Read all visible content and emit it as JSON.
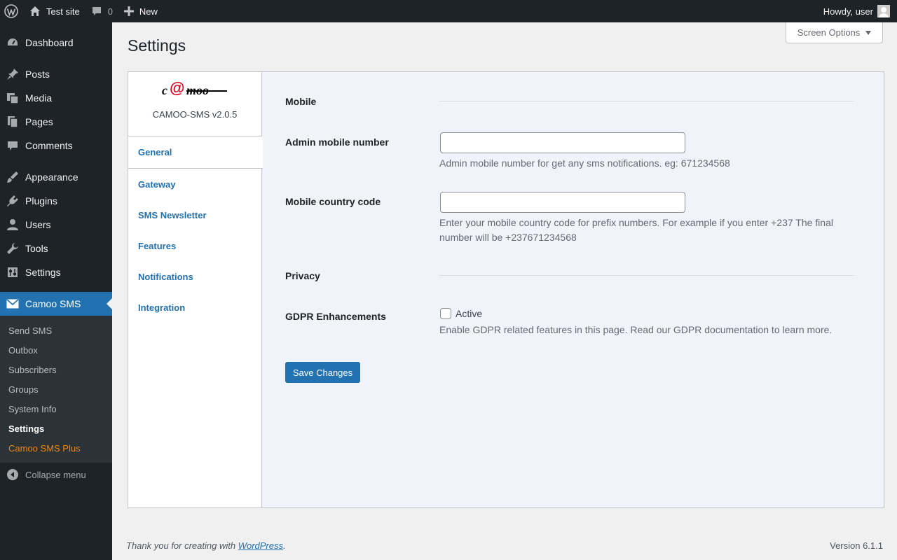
{
  "adminbar": {
    "site_name": "Test site",
    "comments_count": "0",
    "new_label": "New",
    "howdy": "Howdy, user"
  },
  "sidebar": {
    "items": [
      {
        "label": "Dashboard",
        "icon": "dashboard-icon"
      },
      {
        "label": "Posts",
        "icon": "pin-icon"
      },
      {
        "label": "Media",
        "icon": "media-icon"
      },
      {
        "label": "Pages",
        "icon": "pages-icon"
      },
      {
        "label": "Comments",
        "icon": "comment-icon"
      },
      {
        "label": "Appearance",
        "icon": "brush-icon"
      },
      {
        "label": "Plugins",
        "icon": "plugin-icon"
      },
      {
        "label": "Users",
        "icon": "user-icon"
      },
      {
        "label": "Tools",
        "icon": "wrench-icon"
      },
      {
        "label": "Settings",
        "icon": "settings-icon"
      },
      {
        "label": "Camoo SMS",
        "icon": "envelope-icon"
      }
    ],
    "submenu": [
      "Send SMS",
      "Outbox",
      "Subscribers",
      "Groups",
      "System Info",
      "Settings",
      "Camoo SMS Plus"
    ],
    "collapse_label": "Collapse menu"
  },
  "header": {
    "screen_options": "Screen Options",
    "title": "Settings"
  },
  "plugin": {
    "logo_text": "c@moo",
    "version": "CAMOO-SMS v2.0.5",
    "tabs": [
      "General",
      "Gateway",
      "SMS Newsletter",
      "Features",
      "Notifications",
      "Integration"
    ]
  },
  "form": {
    "section_mobile": "Mobile",
    "admin_mobile_label": "Admin mobile number",
    "admin_mobile_value": "",
    "admin_mobile_desc": "Admin mobile number for get any sms notifications. eg: 671234568",
    "country_code_label": "Mobile country code",
    "country_code_value": "",
    "country_code_desc": "Enter your mobile country code for prefix numbers. For example if you enter +237 The final number will be +237671234568",
    "section_privacy": "Privacy",
    "gdpr_label": "GDPR Enhancements",
    "gdpr_checkbox_label": "Active",
    "gdpr_checked": false,
    "gdpr_desc": "Enable GDPR related features in this page. Read our GDPR documentation to learn more.",
    "save_label": "Save Changes"
  },
  "footer": {
    "thanks_prefix": "Thank you for creating with ",
    "thanks_link": "WordPress",
    "thanks_suffix": ".",
    "version": "Version 6.1.1"
  },
  "colors": {
    "accent": "#2271b1",
    "sidebar_bg": "#1d2327",
    "plus_orange": "#f18500"
  }
}
